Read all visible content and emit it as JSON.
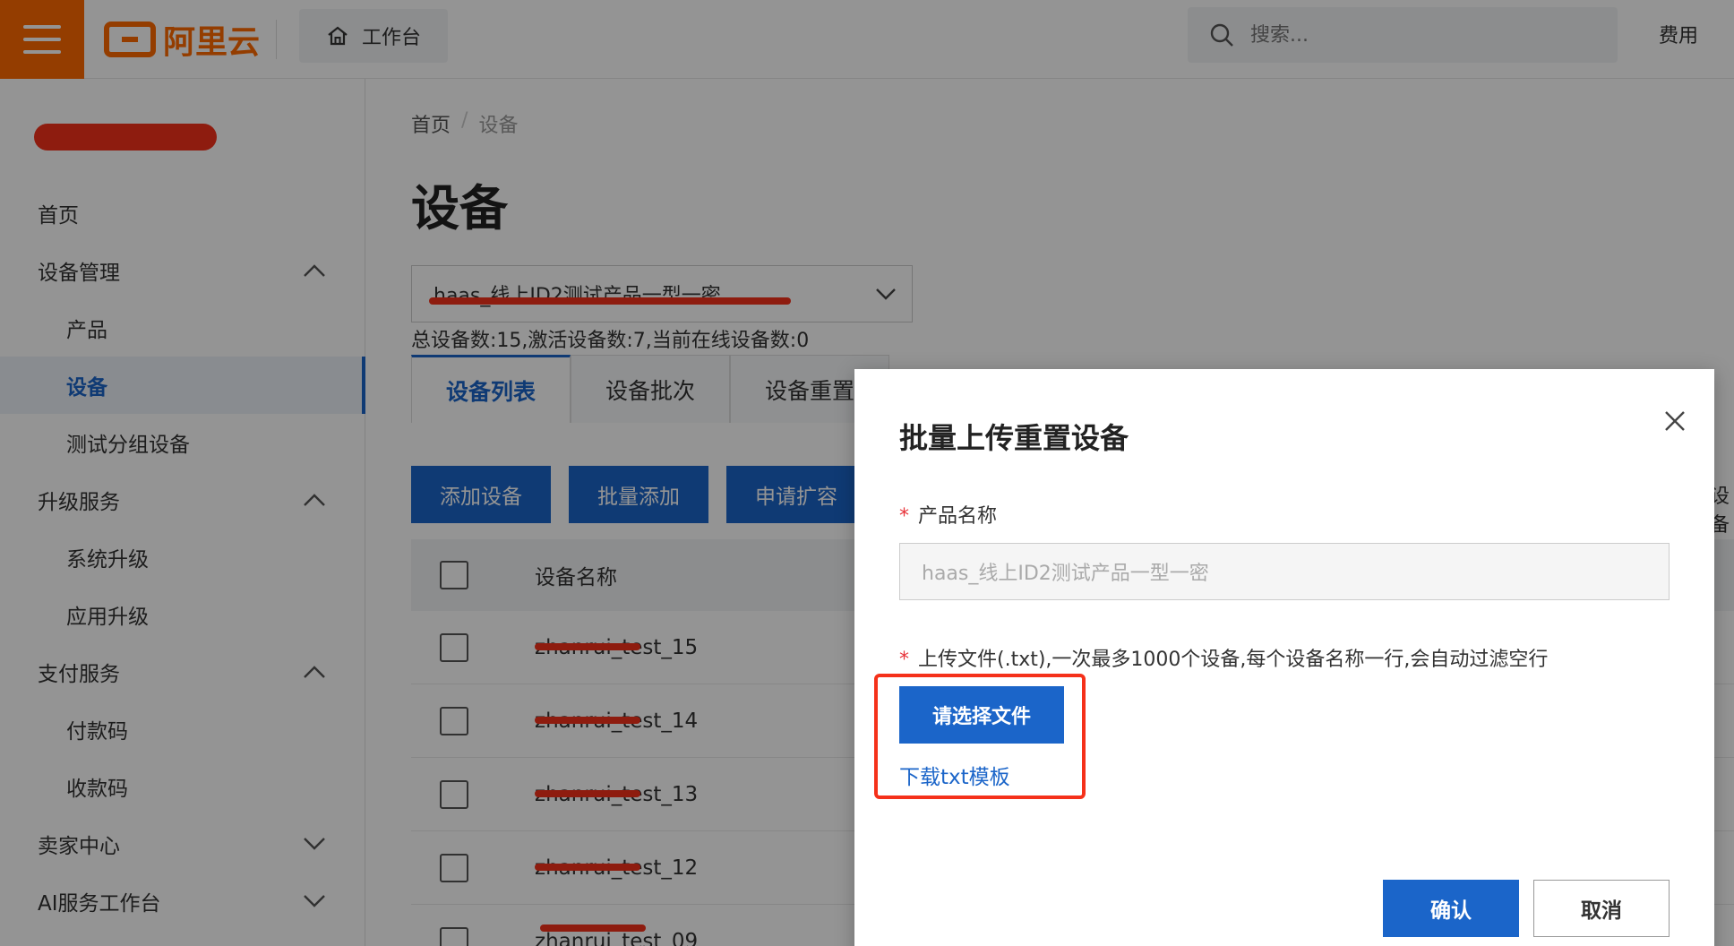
{
  "topbar": {
    "logo_text": "阿里云",
    "workbench_label": "工作台",
    "search_placeholder": "搜索...",
    "right_label": "费用"
  },
  "sidebar": {
    "items": [
      {
        "label": "首页",
        "chevron": ""
      },
      {
        "label": "设备管理",
        "chevron": "up"
      },
      {
        "label": "产品",
        "chevron": ""
      },
      {
        "label": "设备",
        "chevron": ""
      },
      {
        "label": "测试分组设备",
        "chevron": ""
      },
      {
        "label": "升级服务",
        "chevron": "up"
      },
      {
        "label": "系统升级",
        "chevron": ""
      },
      {
        "label": "应用升级",
        "chevron": ""
      },
      {
        "label": "支付服务",
        "chevron": "up"
      },
      {
        "label": "付款码",
        "chevron": ""
      },
      {
        "label": "收款码",
        "chevron": ""
      },
      {
        "label": "卖家中心",
        "chevron": "down"
      },
      {
        "label": "AI服务工作台",
        "chevron": "down"
      }
    ]
  },
  "main": {
    "breadcrumb": {
      "home": "首页",
      "sep": "/",
      "current": "设备"
    },
    "title": "设备",
    "product_select": "haas_线上ID2测试产品一型一密",
    "stats": "总设备数:15,激活设备数:7,当前在线设备数:0",
    "tabs": [
      "设备列表",
      "设备批次",
      "设备重置"
    ],
    "actions": [
      "添加设备",
      "批量添加",
      "申请扩容"
    ],
    "table": {
      "header_name": "设备名称",
      "rows": [
        "zhanrui_test_15",
        "zhanrui_test_14",
        "zhanrui_test_13",
        "zhanrui_test_12",
        "zhanrui_test_09"
      ]
    },
    "right_peek": "设备"
  },
  "dialog": {
    "title": "批量上传重置设备",
    "required_mark": "*",
    "product_label": "产品名称",
    "product_value": "haas_线上ID2测试产品一型一密",
    "upload_label": "上传文件(.txt),一次最多1000个设备,每个设备名称一行,会自动过滤空行",
    "choose_file": "请选择文件",
    "download_template": "下载txt模板",
    "confirm": "确认",
    "cancel": "取消"
  },
  "colors": {
    "brand_orange": "#ff6a00",
    "primary_blue": "#1b65c9",
    "redaction_red": "#f5311a"
  }
}
